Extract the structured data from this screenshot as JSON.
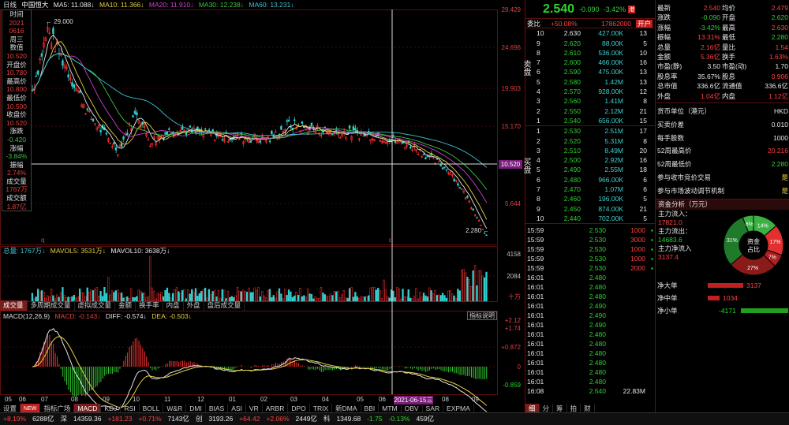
{
  "header": {
    "period": "日线",
    "name": "中国恒大",
    "ma5": "MA5: 11.088↓",
    "ma10": "MA10: 11.366↓",
    "ma20": "MA20: 11.910↓",
    "ma30": "MA30: 12.238↓",
    "ma60": "MA60: 13.231↓"
  },
  "tooltip": [
    {
      "l": "时间",
      "v": "2021"
    },
    {
      "l": "",
      "v": "0616"
    },
    {
      "l": "周三",
      "v": ""
    },
    {
      "l": "数值",
      "v": "10.520"
    },
    {
      "l": "开盘价",
      "v": "10.780"
    },
    {
      "l": "最高价",
      "v": "10.800"
    },
    {
      "l": "最低价",
      "v": "10.500"
    },
    {
      "l": "收盘价",
      "v": "10.520"
    },
    {
      "l": "涨跌",
      "v": "-0.420"
    },
    {
      "l": "涨幅",
      "v": "-3.84%"
    },
    {
      "l": "振幅",
      "v": "2.74%"
    },
    {
      "l": "成交量",
      "v": "1767万"
    },
    {
      "l": "成交额",
      "v": "1.87亿"
    }
  ],
  "price_axis": [
    "29.429",
    "24.696",
    "19.903",
    "15.170",
    "10.520",
    "5.644"
  ],
  "cursor_price": "10.520",
  "high_label": "29.000",
  "low_label": "2.280",
  "vol_header": {
    "a": "总量: 1767万↓",
    "b": "MAVOL5: 3531万↓",
    "c": "MAVOL10: 3638万↓"
  },
  "vol_axis": [
    "4158",
    "2084",
    "十万"
  ],
  "tabs_mid": [
    "成交量",
    "多周期成交量",
    "虚拟成交量",
    "金额",
    "换手率",
    "内盘",
    "外盘",
    "盘后成交量"
  ],
  "macd_header": {
    "a": "MACD(12,26,9)",
    "b": "MACD: -0.143↓",
    "c": "DIFF: -0.574↓",
    "d": "DEA: -0.503↓"
  },
  "macd_btn": "指标说明",
  "macd_axis": [
    "+2.12",
    "+1.74",
    "+0.872",
    "0",
    "-0.859"
  ],
  "months": [
    "05",
    "06",
    "07",
    "08",
    "09",
    "10",
    "11",
    "12",
    "01",
    "02",
    "03",
    "04",
    "05",
    "06",
    "08",
    "09"
  ],
  "cursor_date": "2021-06-15三",
  "tabs_bottom": [
    "设置",
    "NEW",
    "指标广场",
    "MACD",
    "KDJ",
    "RSI",
    "BOLL",
    "W&R",
    "DMI",
    "BIAS",
    "ASI",
    "VR",
    "ARBR",
    "DPO",
    "TRIX",
    "新DMA",
    "BBI",
    "MTM",
    "OBV",
    "SAR",
    "EXPMA"
  ],
  "quote": {
    "price": "2.540",
    "change": "-0.090",
    "pct": "-3.42%",
    "icon": "港",
    "weibi_label": "委比",
    "weibi": "+50.08%",
    "weicha": "17862000",
    "open_btn": "开户",
    "sell_label": "卖盘",
    "buy_label": "买盘",
    "asks": [
      [
        "10",
        "2.630",
        "427.00K",
        "13"
      ],
      [
        "9",
        "2.620",
        "88.00K",
        "5"
      ],
      [
        "8",
        "2.610",
        "536.00K",
        "10"
      ],
      [
        "7",
        "2.600",
        "466.00K",
        "16"
      ],
      [
        "6",
        "2.590",
        "475.00K",
        "13"
      ],
      [
        "5",
        "2.580",
        "1.42M",
        "13"
      ],
      [
        "4",
        "2.570",
        "928.00K",
        "12"
      ],
      [
        "3",
        "2.560",
        "1.41M",
        "8"
      ],
      [
        "2",
        "2.550",
        "2.12M",
        "21"
      ],
      [
        "1",
        "2.540",
        "656.00K",
        "15"
      ]
    ],
    "bids": [
      [
        "1",
        "2.530",
        "2.51M",
        "17"
      ],
      [
        "2",
        "2.520",
        "5.31M",
        "8"
      ],
      [
        "3",
        "2.510",
        "8.49M",
        "20"
      ],
      [
        "4",
        "2.500",
        "2.92M",
        "16"
      ],
      [
        "5",
        "2.490",
        "2.55M",
        "18"
      ],
      [
        "6",
        "2.480",
        "966.00K",
        "6"
      ],
      [
        "7",
        "2.470",
        "1.07M",
        "6"
      ],
      [
        "8",
        "2.460",
        "196.00K",
        "5"
      ],
      [
        "9",
        "2.450",
        "874.00K",
        "21"
      ],
      [
        "10",
        "2.440",
        "702.00K",
        "5"
      ]
    ],
    "ticks": [
      [
        "15:59",
        "2.530",
        "1000",
        "S"
      ],
      [
        "15:59",
        "2.530",
        "3000",
        "S"
      ],
      [
        "15:59",
        "2.530",
        "1000",
        "S"
      ],
      [
        "15:59",
        "2.530",
        "1000",
        "S"
      ],
      [
        "15:59",
        "2.530",
        "2000",
        "S"
      ],
      [
        "16:01",
        "2.480",
        "",
        ""
      ],
      [
        "16:01",
        "2.480",
        "",
        ""
      ],
      [
        "16:01",
        "2.480",
        "",
        ""
      ],
      [
        "16:01",
        "2.490",
        "",
        ""
      ],
      [
        "16:01",
        "2.490",
        "",
        ""
      ],
      [
        "16:01",
        "2.490",
        "",
        ""
      ],
      [
        "16:01",
        "2.480",
        "",
        ""
      ],
      [
        "16:01",
        "2.480",
        "",
        ""
      ],
      [
        "16:01",
        "2.480",
        "",
        ""
      ],
      [
        "16:01",
        "2.480",
        "",
        ""
      ],
      [
        "16:01",
        "2.480",
        "",
        ""
      ],
      [
        "16:01",
        "2.480",
        "",
        ""
      ],
      [
        "16:08",
        "2.540",
        "22.83M",
        ""
      ]
    ],
    "bottom_tabs": [
      "细",
      "分",
      "筹",
      "拍",
      "财"
    ]
  },
  "stats": [
    [
      "最新",
      "2.540",
      "均价",
      "2.479"
    ],
    [
      "涨跌",
      "-0.090",
      "开盘",
      "2.620"
    ],
    [
      "涨幅",
      "-3.42%",
      "最高",
      "2.630"
    ],
    [
      "振幅",
      "13.31%",
      "最低",
      "2.280"
    ],
    [
      "总量",
      "2.16亿",
      "量比",
      "1.54"
    ],
    [
      "金额",
      "5.36亿",
      "换手",
      "1.63%"
    ],
    [
      "市盈(静)",
      "3.50",
      "市盈(动)",
      "1.70"
    ],
    [
      "股息率",
      "35.67%",
      "股息",
      "0.906"
    ],
    [
      "总市值",
      "336.6亿",
      "流通值",
      "336.6亿"
    ],
    [
      "外盘",
      "1.04亿",
      "内盘",
      "1.12亿"
    ]
  ],
  "info": [
    [
      "货币单位（港元）",
      "HKD"
    ],
    [
      "买卖价差",
      "0.010"
    ],
    [
      "每手股数",
      "1000"
    ],
    [
      "52周最高价",
      "20.216"
    ],
    [
      "52周最低价",
      "2.280"
    ],
    [
      "参与收市竞价交易",
      "是"
    ],
    [
      "参与市场波动调节机制",
      "是"
    ]
  ],
  "fund": {
    "title": "资金分析（万元）",
    "in_label": "主力流入：",
    "in_val": "17821.0",
    "out_label": "主力流出：",
    "out_val": "14683.6",
    "net_label": "主力净流入",
    "net_val": "3137.4",
    "donut_label": "资金占比",
    "slices": [
      {
        "label": "14%",
        "color": "#3cb043",
        "val": 14
      },
      {
        "label": "17%",
        "color": "#e03030",
        "val": 17
      },
      {
        "label": "7%",
        "color": "#b02020",
        "val": 7
      },
      {
        "label": "27%",
        "color": "#8b1a1a",
        "val": 27
      },
      {
        "label": "31%",
        "color": "#1f7a2a",
        "val": 31
      },
      {
        "label": "6%",
        "color": "#3cb043",
        "val": 6
      }
    ]
  },
  "flows": [
    {
      "l": "净大单",
      "v": "3137",
      "neg": false,
      "w": 0.75
    },
    {
      "l": "净中单",
      "v": "1034",
      "neg": false,
      "w": 0.25
    },
    {
      "l": "净小单",
      "v": "-4171",
      "neg": true,
      "w": 1.0
    }
  ],
  "bottombar": [
    "+8.19%",
    "6288亿",
    "深",
    "14359.36",
    "+181.23",
    "+0.71%",
    "7143亿",
    "创",
    "3193.26",
    "+64.42",
    "+2.06%",
    "2449亿",
    "科",
    "1349.68",
    "-1.75",
    "-0.13%",
    "459亿"
  ]
}
